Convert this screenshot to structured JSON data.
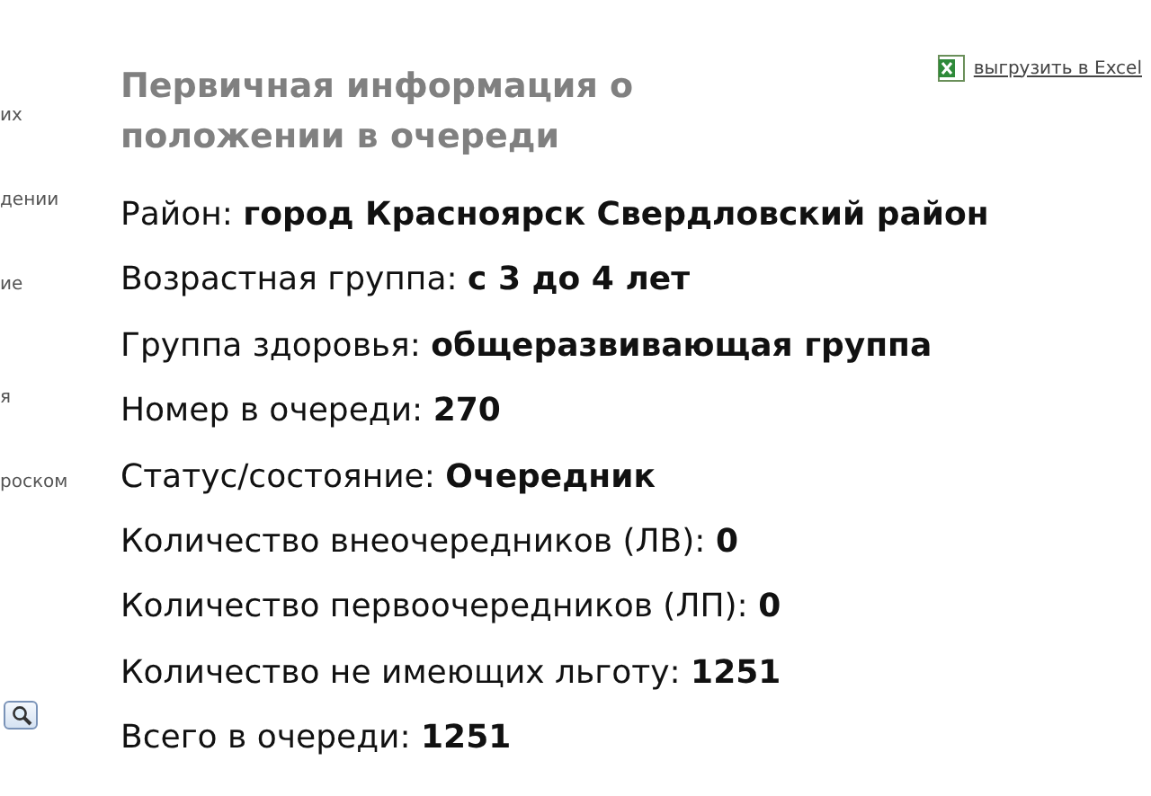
{
  "sidebar": {
    "items": [
      "их",
      "дении",
      "ие",
      "я",
      "роском"
    ]
  },
  "export_link": {
    "label": "выгрузить в Excel"
  },
  "title": "Первичная информация о положении в очереди",
  "fields": [
    {
      "label": "Район:",
      "value": "город Красноярск Свердловский район"
    },
    {
      "label": "Возрастная группа:",
      "value": "с 3 до 4 лет"
    },
    {
      "label": "Группа здоровья:",
      "value": "общеразвивающая группа"
    },
    {
      "label": "Номер в очереди:",
      "value": "270"
    },
    {
      "label": "Статус/состояние:",
      "value": "Очередник"
    },
    {
      "label": "Количество внеочередников (ЛВ):",
      "value": "0"
    },
    {
      "label": "Количество первоочередников (ЛП):",
      "value": "0"
    },
    {
      "label": "Количество не имеющих льготу:",
      "value": "1251"
    },
    {
      "label": "Всего в очереди:",
      "value": "1251"
    }
  ]
}
